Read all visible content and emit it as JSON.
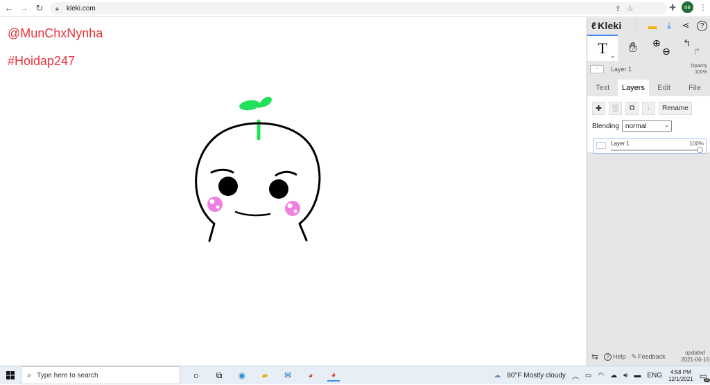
{
  "browser": {
    "url": "kleki.com",
    "profile_initials": "nè"
  },
  "canvas": {
    "tag1": "@MunChxNynha",
    "tag2": "#Hoidap247",
    "colors": {
      "tag": "#e8333d",
      "sprout": "#22e05a",
      "cheek": "#f080e0",
      "ink": "#000000"
    }
  },
  "panel": {
    "app_name": "Kleki",
    "layer_name": "Layer 1",
    "opacity_label": "Opacity",
    "opacity_value": "100%",
    "tabs": [
      {
        "label": "Text",
        "active": false
      },
      {
        "label": "Layers",
        "active": true
      },
      {
        "label": "Edit",
        "active": false
      },
      {
        "label": "File",
        "active": false
      }
    ],
    "rename_label": "Rename",
    "blending_label": "Blending",
    "blending_value": "normal",
    "layer_item": {
      "name": "Layer 1",
      "opacity": "100%",
      "opacity_fraction": 1.0
    },
    "help_label": "Help",
    "feedback_label": "Feedback",
    "updated_label": "updated",
    "updated_date": "2021-06-16"
  },
  "taskbar": {
    "search_placeholder": "Type here to search",
    "weather": "80°F  Mostly cloudy",
    "language": "ENG",
    "time": "4:58 PM",
    "date": "12/1/2021",
    "notification_count": "10"
  }
}
